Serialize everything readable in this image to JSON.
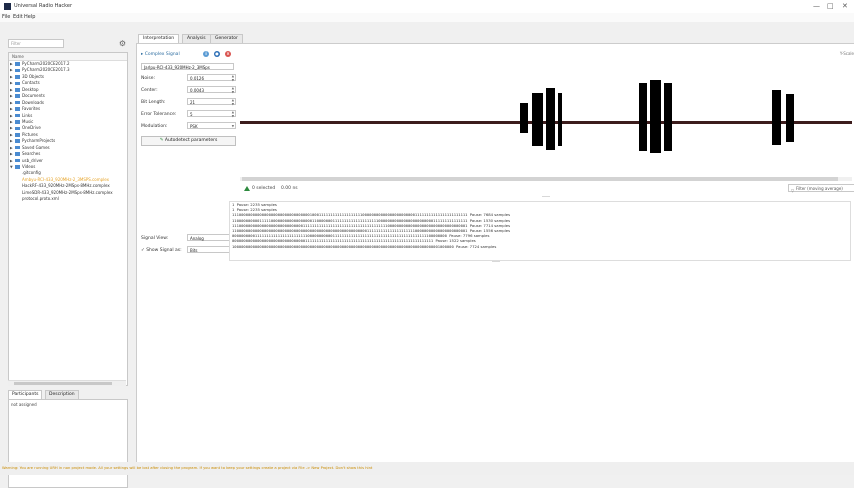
{
  "app": {
    "title": "Universal Radio Hacker"
  },
  "window_controls": {
    "minimize": "—",
    "maximize": "□",
    "close": "✕"
  },
  "menu": {
    "items": [
      "File",
      "Edit",
      "Help"
    ]
  },
  "left_panel": {
    "filter_placeholder": "Filter",
    "filter_button": "⚙",
    "tree_header": "Name",
    "tree_items": [
      {
        "label": "PyCharm2020CE2017.2",
        "type": "folder"
      },
      {
        "label": "PyCharm2020CE2017.3",
        "type": "folder"
      },
      {
        "label": "3D Objects",
        "type": "folder"
      },
      {
        "label": "Contacts",
        "type": "folder"
      },
      {
        "label": "Desktop",
        "type": "folder"
      },
      {
        "label": "Documents",
        "type": "folder"
      },
      {
        "label": "Downloads",
        "type": "folder"
      },
      {
        "label": "Favorites",
        "type": "folder"
      },
      {
        "label": "Links",
        "type": "folder"
      },
      {
        "label": "Music",
        "type": "folder"
      },
      {
        "label": "OneDrive",
        "type": "folder"
      },
      {
        "label": "Pictures",
        "type": "folder"
      },
      {
        "label": "PycharmProjects",
        "type": "folder"
      },
      {
        "label": "Saved Games",
        "type": "folder"
      },
      {
        "label": "Searches",
        "type": "folder"
      },
      {
        "label": "usb_driver",
        "type": "folder"
      },
      {
        "label": "Videos",
        "type": "folder",
        "expanded": true
      },
      {
        "label": ".gitconfig",
        "type": "file"
      },
      {
        "label": "Ambyu-RCI-433_920MHz-2_3MSPS.complex",
        "type": "file",
        "selected": true
      },
      {
        "label": "HackRF-433_920MHz-2MSps-8MHz.complex",
        "type": "file"
      },
      {
        "label": "LimeSDR-433_920MHz-2MSps-8MHz.complex",
        "type": "file"
      },
      {
        "label": "protocol.proto.xml",
        "type": "file"
      }
    ]
  },
  "participants": {
    "tabs": [
      "Participants",
      "Description"
    ],
    "content": "not assigned"
  },
  "main_tabs": [
    "Interpretation",
    "Analysis",
    "Generator"
  ],
  "signal": {
    "checkbox_label": "Complex Signal",
    "name": "Jarlpu-RCI-433_920MHz-2_3MSps",
    "noise_label": "Noise:",
    "noise_value": "0.0126",
    "center_label": "Center:",
    "center_value": "0.0043",
    "bit_length_label": "Bit Length:",
    "bit_length_value": "21",
    "error_tolerance_label": "Error Tolerance:",
    "error_tolerance_value": "5",
    "modulation_label": "Modulation:",
    "modulation_value": "PSK",
    "autodetect_label": "Autodetect parameters",
    "signal_view_label": "Signal View:",
    "signal_view_value": "Analog",
    "show_signal_as_label": "Show Signal as:",
    "show_signal_as_value": "Bits",
    "selected_label": "0 selected",
    "selected_time": "0.00 ns",
    "filter_label": "Filter (moving average)",
    "scale_label": "Y-Scale"
  },
  "bits": [
    {
      "bits": "1",
      "pause": "Pause: 2235 samples"
    },
    {
      "bits": "1",
      "pause": "Pause: 2235 samples"
    },
    {
      "bits": "1110000000000000000000000000000000100011111111111111111110000000000000000000000011111111111111111111111",
      "pause": "Pause: 7684 samples"
    },
    {
      "bits": "1100000000001111100000000000000000011000000011111111111111111111000000000000000000000000111111111111111",
      "pause": "Pause: 1530 samples"
    },
    {
      "bits": "1110000000000000000000000000000111111111111111111111111111111111111100000000000000000000000000000000001",
      "pause": "Pause: 7714 samples"
    },
    {
      "bits": "1100000000000000000000000000000000000000000000000000000000011111111111111111111100000000000000000000001",
      "pause": "Pause: 1556 samples"
    },
    {
      "bits": "0000000000111111111111111111111110000000000011111111111111111111111111111111111111111100000000",
      "pause": "Pause: 7796 samples"
    },
    {
      "bits": "0000000000000000000000000000000011111111111111111111111111111111111111111111111111111111",
      "pause": "Pause: 1522 samples"
    },
    {
      "bits": "1000000000000000000000000000000000000000000000000000000000000000000000000000000000000000001000000",
      "pause": "Pause: 7724 samples"
    }
  ],
  "footer": {
    "text": "Warning: You are running URH in non project mode. All your settings will be lost after closing the program. If you want to keep your settings create a project via File -> New Project. Don't show this hint"
  },
  "colors": {
    "accent": "#e6a328",
    "signal_line": "#3c1c1c",
    "close_icon": "#d9534f",
    "info_icon": "#2a6db5"
  }
}
